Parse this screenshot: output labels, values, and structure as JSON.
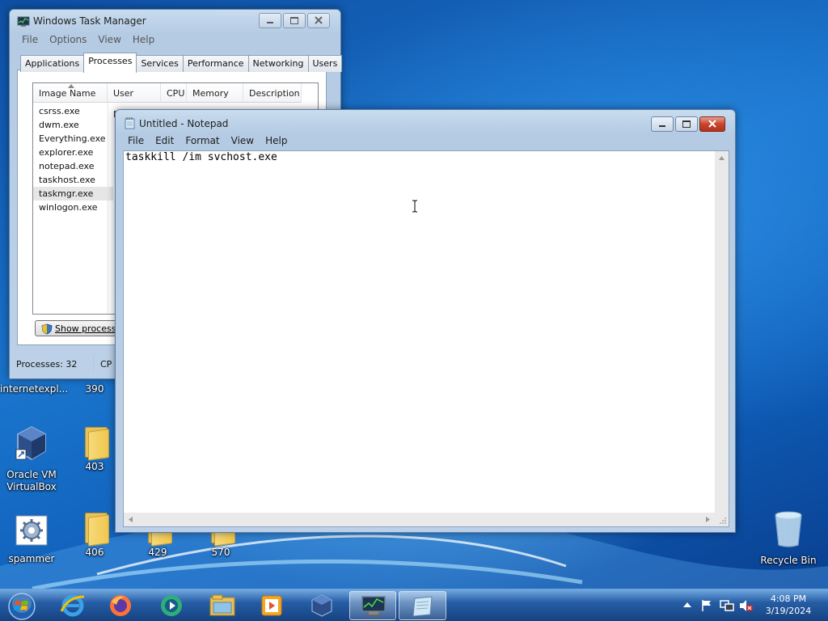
{
  "desktop": {
    "icons": [
      {
        "label": "internetexpl...",
        "kind": "ie-partial"
      },
      {
        "label": "390",
        "kind": "folder-partial"
      },
      {
        "label": "Oracle VM VirtualBox",
        "kind": "virtualbox"
      },
      {
        "label": "403",
        "kind": "folder"
      },
      {
        "label": "spammer",
        "kind": "settings"
      },
      {
        "label": "406",
        "kind": "folder"
      },
      {
        "label": "429",
        "kind": "folder"
      },
      {
        "label": "570",
        "kind": "folder"
      },
      {
        "label": "Recycle Bin",
        "kind": "recycle-bin"
      }
    ]
  },
  "taskmgr": {
    "title": "Windows Task Manager",
    "menu": [
      "File",
      "Options",
      "View",
      "Help"
    ],
    "tabs": [
      "Applications",
      "Processes",
      "Services",
      "Performance",
      "Networking",
      "Users"
    ],
    "active_tab": "Processes",
    "columns": [
      "Image Name",
      "User Name",
      "CPU",
      "Memory (...",
      "Description"
    ],
    "processes": [
      "csrss.exe",
      "dwm.exe",
      "Everything.exe",
      "explorer.exe",
      "notepad.exe",
      "taskhost.exe",
      "taskmgr.exe",
      "winlogon.exe"
    ],
    "selected_process": "taskmgr.exe",
    "show_processes_label": "Show processes",
    "status_processes": "Processes: 32",
    "status_cpu": "CP"
  },
  "notepad": {
    "title": "Untitled - Notepad",
    "menu": [
      "File",
      "Edit",
      "Format",
      "View",
      "Help"
    ],
    "content": "taskkill /im svchost.exe"
  },
  "taskbar": {
    "items": [
      "start-orb",
      "internet-explorer",
      "firefox",
      "media-app",
      "file-explorer",
      "media-player",
      "virtualbox",
      "task-manager",
      "notepad"
    ],
    "active": [
      "task-manager",
      "notepad"
    ],
    "time": "4:08 PM",
    "date": "3/19/2024"
  },
  "colors": {
    "desktop_blue": "#1a6fc4",
    "window_frame": "#bcd1e8",
    "close_red": "#c8452c",
    "folder_yellow": "#f0c84e"
  }
}
